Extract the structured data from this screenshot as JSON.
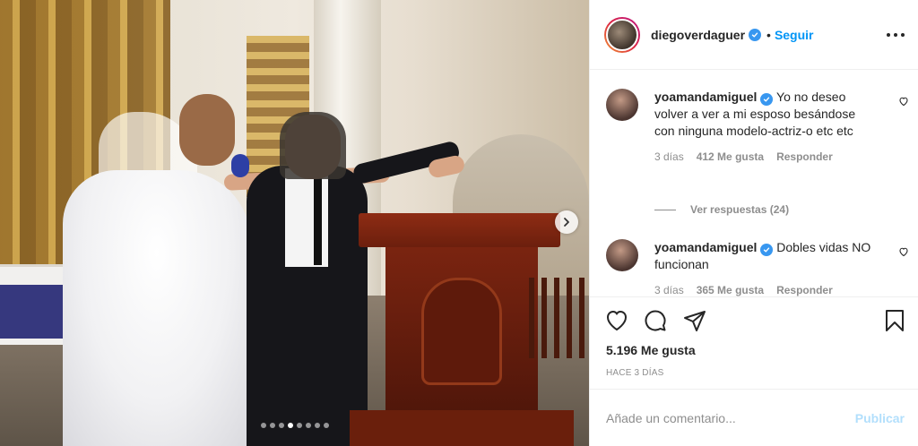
{
  "post": {
    "username": "diegoverdaguer",
    "separator": "•",
    "follow_label": "Seguir",
    "carousel": {
      "total": 8,
      "active": 4
    },
    "comments": [
      {
        "username": "yoamandamiguel",
        "text": "Yo no deseo volver a ver a mi esposo besándose con ninguna modelo-actriz-o etc etc",
        "age": "3 días",
        "likes": "412 Me gusta",
        "reply": "Responder"
      },
      {
        "username": "yoamandamiguel",
        "text": "Dobles vidas NO funcionan",
        "age": "3 días",
        "likes": "365 Me gusta",
        "reply": "Responder"
      }
    ],
    "view_replies": "Ver respuestas (24)",
    "like_count": "5.196 Me gusta",
    "date": "HACE 3 DÍAS",
    "comment_placeholder": "Añade un comentario...",
    "publish_label": "Publicar"
  },
  "colors": {
    "accent": "#0095f6",
    "verified": "#3897f0",
    "muted": "#8e8e8e",
    "publish_disabled": "#b2dffc"
  },
  "icons": [
    "chevron-right-icon",
    "verified-icon",
    "more-icon",
    "heart-icon",
    "comment-icon",
    "share-icon",
    "bookmark-icon"
  ]
}
